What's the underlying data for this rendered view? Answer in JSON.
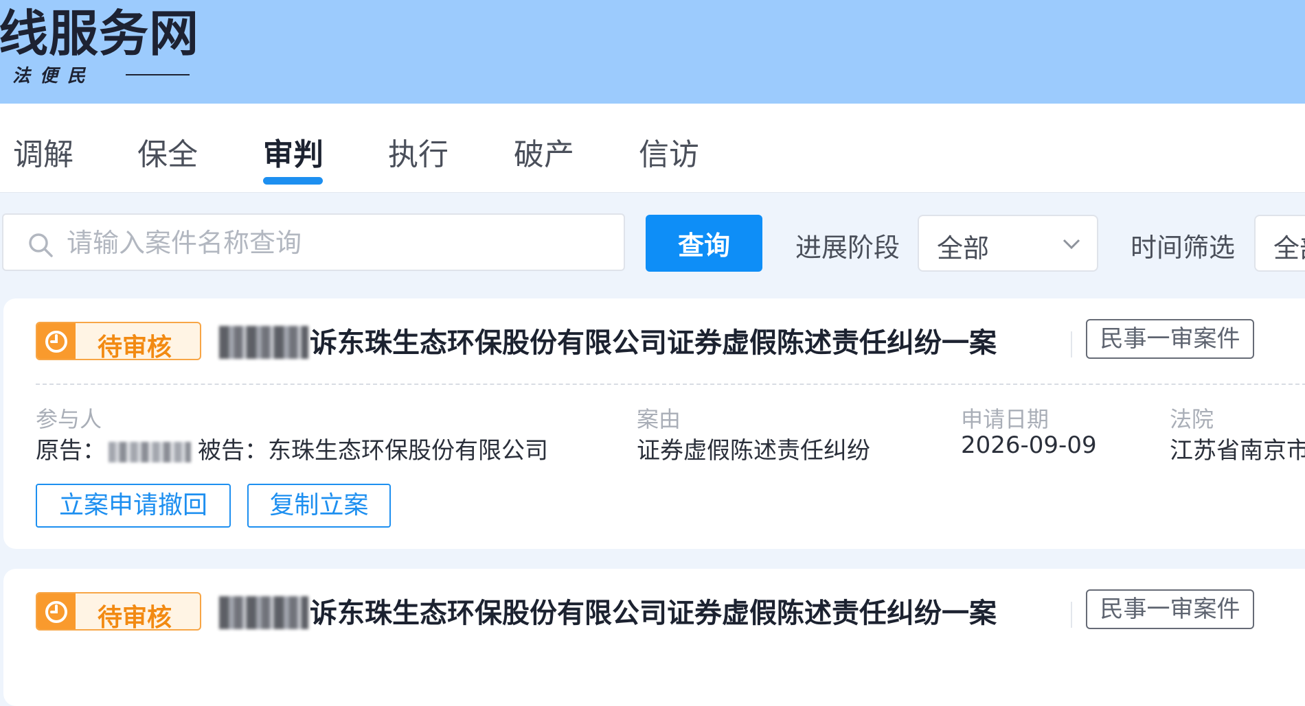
{
  "header": {
    "site_title": "线服务网",
    "site_slogan": "法便民"
  },
  "nav": {
    "tabs": [
      {
        "label": "调解",
        "active": false
      },
      {
        "label": "保全",
        "active": false
      },
      {
        "label": "审判",
        "active": true
      },
      {
        "label": "执行",
        "active": false
      },
      {
        "label": "破产",
        "active": false
      },
      {
        "label": "信访",
        "active": false
      }
    ]
  },
  "search": {
    "placeholder": "请输入案件名称查询",
    "value": "",
    "button_label": "查询"
  },
  "filters": {
    "stage": {
      "label": "进展阶段",
      "value": "全部"
    },
    "time": {
      "label": "时间筛选",
      "value": "全部"
    }
  },
  "cases": [
    {
      "status": "待审核",
      "title": "诉东珠生态环保股份有限公司证券虚假陈述责任纠纷一案",
      "type": "民事一审案件",
      "participants_label": "参与人",
      "plaintiff_prefix": "原告：",
      "defendant_text": "被告：东珠生态环保股份有限公司",
      "cause_label": "案由",
      "cause_value": "证券虚假陈述责任纠纷",
      "date_label": "申请日期",
      "date_value": "2026-09-09",
      "court_label": "法院",
      "court_value": "江苏省南京市",
      "actions": [
        "立案申请撤回",
        "复制立案"
      ]
    },
    {
      "status": "待审核",
      "title": "诉东珠生态环保股份有限公司证券虚假陈述责任纠纷一案",
      "type": "民事一审案件"
    }
  ],
  "colors": {
    "banner": "#9ccbfd",
    "accent": "#1d8ff0",
    "pending": "#f99a2d"
  }
}
